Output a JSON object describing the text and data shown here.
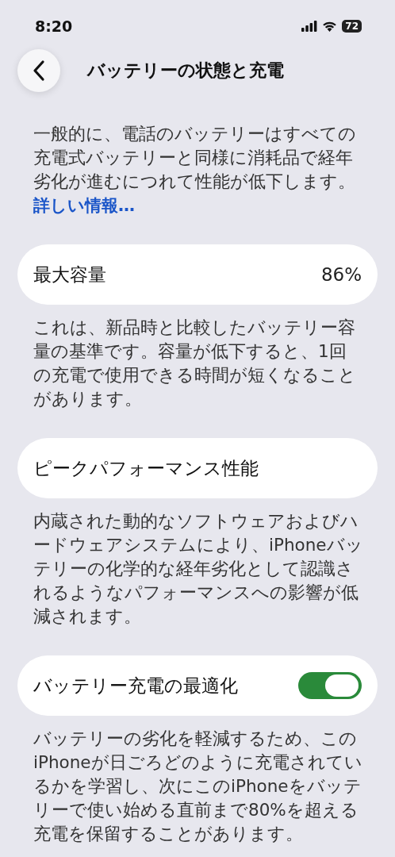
{
  "status_bar": {
    "time": "8:20",
    "battery": "72"
  },
  "header": {
    "title": "バッテリーの状態と充電"
  },
  "intro": {
    "text": "一般的に、電話のバッテリーはすべての充電式バッテリーと同様に消耗品で経年劣化が進むにつれて性能が低下します。",
    "link": "詳しい情報…"
  },
  "sections": [
    {
      "kind": "value",
      "label": "最大容量",
      "value": "86%",
      "footer": "これは、新品時と比較したバッテリー容量の基準です。容量が低下すると、1回の充電で使用できる時間が短くなることがあります。"
    },
    {
      "kind": "plain",
      "label": "ピークパフォーマンス性能",
      "footer": "内蔵された動的なソフトウェアおよびハードウェアシステムにより、iPhoneバッテリーの化学的な経年劣化として認識されるようなパフォーマンスへの影響が低減されます。"
    },
    {
      "kind": "toggle",
      "label": "バッテリー充電の最適化",
      "on": true,
      "footer": "バッテリーの劣化を軽減するため、このiPhoneが日ごろどのように充電されているかを学習し、次にこのiPhoneをバッテリーで使い始める直前まで80%を超える充電を保留することがあります。"
    }
  ]
}
